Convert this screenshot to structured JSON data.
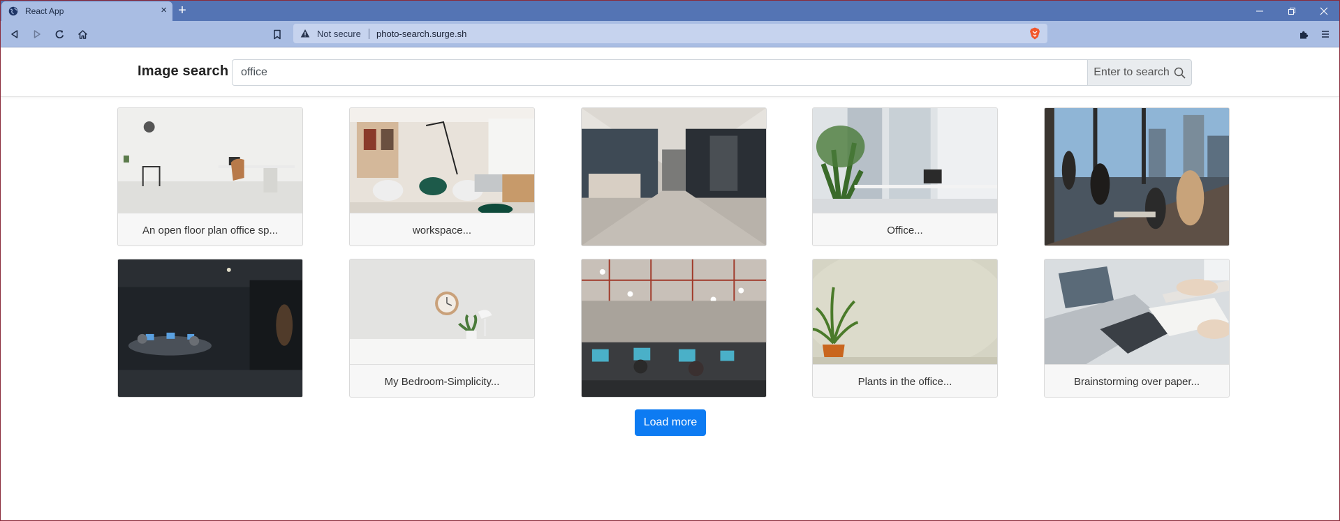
{
  "browser": {
    "tab_title": "React App",
    "tab_close": "×",
    "new_tab": "+",
    "security_label": "Not secure",
    "url": "photo-search.surge.sh",
    "colors": {
      "tabstrip": "#5474b4",
      "toolbar": "#a9bde3",
      "address": "#c6d3ee"
    }
  },
  "header": {
    "title": "Image search",
    "search_value": "office",
    "search_button_label": "Enter to search",
    "search_icon": "search-icon"
  },
  "results": [
    {
      "caption": "An open floor plan office sp..."
    },
    {
      "caption": "workspace..."
    },
    {
      "caption": ""
    },
    {
      "caption": "Office..."
    },
    {
      "caption": ""
    },
    {
      "caption": ""
    },
    {
      "caption": "My Bedroom-Simplicity..."
    },
    {
      "caption": ""
    },
    {
      "caption": "Plants in the office..."
    },
    {
      "caption": "Brainstorming over paper..."
    }
  ],
  "load_more_label": "Load more",
  "accent_color": "#0d7bf2"
}
